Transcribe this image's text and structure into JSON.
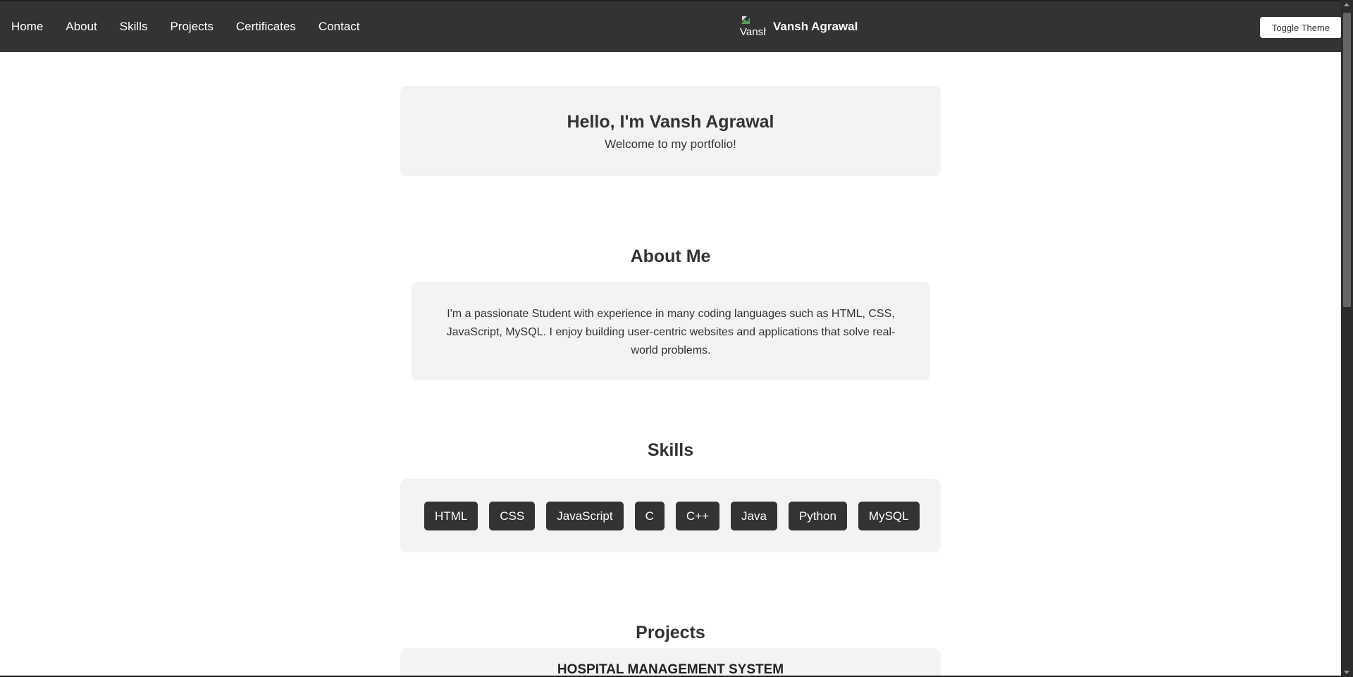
{
  "nav": {
    "links": [
      "Home",
      "About",
      "Skills",
      "Projects",
      "Certificates",
      "Contact"
    ],
    "brand_name": "Vansh Agrawal",
    "logo_alt": "Vansh",
    "toggle_label": "Toggle Theme"
  },
  "hero": {
    "title": "Hello, I'm Vansh Agrawal",
    "subtitle": "Welcome to my portfolio!"
  },
  "about": {
    "title": "About Me",
    "text": "I'm a passionate Student with experience in many coding languages such as HTML, CSS, JavaScript, MySQL. I enjoy building user-centric websites and applications that solve real-world problems."
  },
  "skills": {
    "title": "Skills",
    "items": [
      "HTML",
      "CSS",
      "JavaScript",
      "C",
      "C++",
      "Java",
      "Python",
      "MySQL"
    ]
  },
  "projects": {
    "title": "Projects",
    "items": [
      "HOSPITAL MANAGEMENT SYSTEM"
    ]
  },
  "colors": {
    "navbar": "#333333",
    "card": "#f3f3f3",
    "skill_chip": "#333333",
    "text": "#333333"
  }
}
